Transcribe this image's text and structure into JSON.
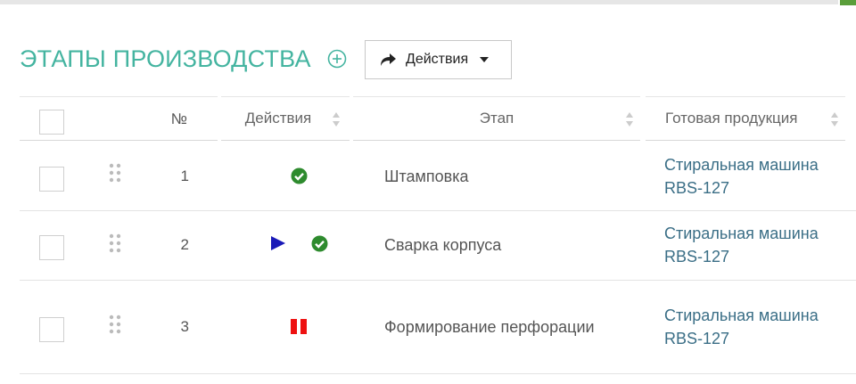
{
  "header": {
    "title": "ЭТАПЫ ПРОИЗВОДСТВА",
    "actions_label": "Действия"
  },
  "table": {
    "columns": {
      "number": "№",
      "actions": "Действия",
      "stage": "Этап",
      "product": "Готовая продукция"
    },
    "rows": [
      {
        "num": "1",
        "stage": "Штамповка",
        "product": "Стиральная машина RBS-127",
        "actions": [
          "check-circle-icon"
        ]
      },
      {
        "num": "2",
        "stage": "Сварка корпуса",
        "product": "Стиральная машина RBS-127",
        "actions": [
          "play-icon",
          "check-circle-icon"
        ]
      },
      {
        "num": "3",
        "stage": "Формирование перфорации",
        "product": "Стиральная машина RBS-127",
        "actions": [
          "pause-icon"
        ]
      }
    ]
  },
  "colors": {
    "title": "#44b4a0",
    "link": "#3a6e86",
    "check": "#2e8b2e",
    "play": "#1a1ab8",
    "pause": "#ee1111"
  }
}
